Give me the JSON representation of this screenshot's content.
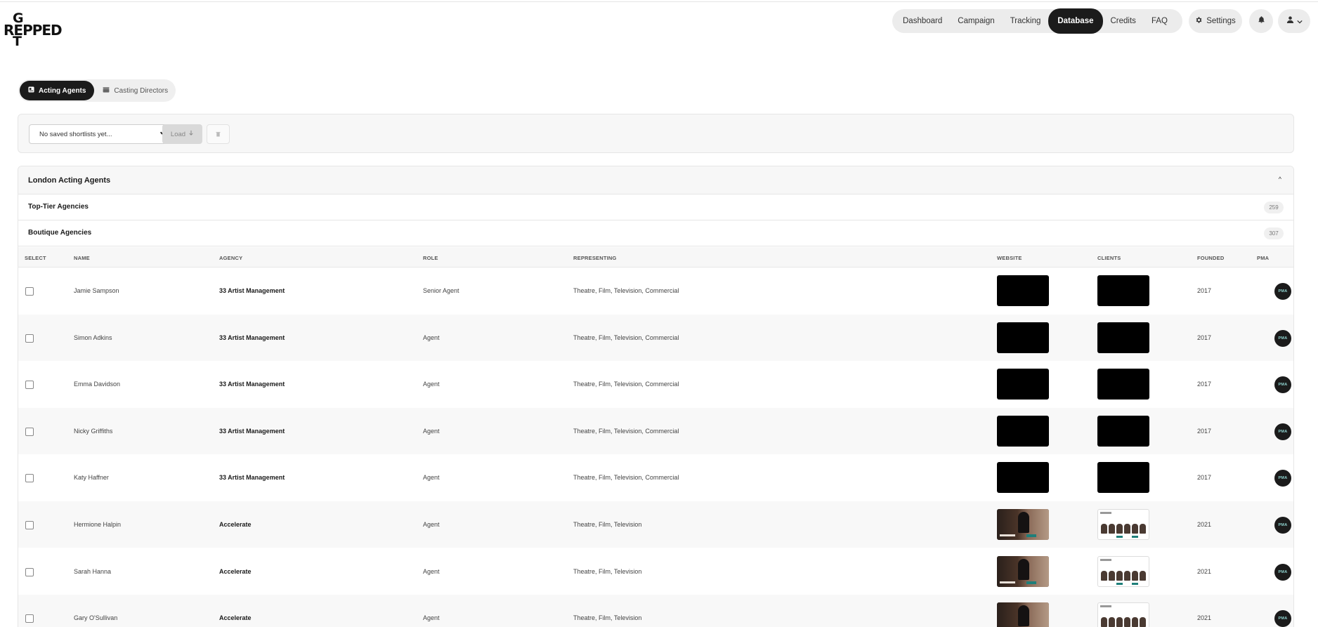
{
  "logo": {
    "line1": "G",
    "line2": "REPPED",
    "line3": "T"
  },
  "nav": {
    "items": [
      {
        "label": "Dashboard",
        "active": false
      },
      {
        "label": "Campaign",
        "active": false
      },
      {
        "label": "Tracking",
        "active": false
      },
      {
        "label": "Database",
        "active": true
      },
      {
        "label": "Credits",
        "active": false
      },
      {
        "label": "FAQ",
        "active": false
      }
    ],
    "settings_label": "Settings",
    "icons": {
      "settings": "gear-icon",
      "notifications": "bell-icon",
      "user": "user-icon",
      "user_menu": "chevron-down-icon"
    }
  },
  "tabs": [
    {
      "label": "Acting Agents",
      "icon": "id-card-icon",
      "active": true
    },
    {
      "label": "Casting Directors",
      "icon": "clapperboard-icon",
      "active": false
    }
  ],
  "shortlist": {
    "select_value": "No saved shortlists yet...",
    "load_label": "Load",
    "delete_icon": "trash-icon"
  },
  "database": {
    "section_title": "London Acting Agents",
    "collapse_icon": "^",
    "categories": [
      {
        "label": "Top-Tier Agencies",
        "count": "259"
      },
      {
        "label": "Boutique Agencies",
        "count": "307"
      }
    ],
    "columns": [
      "SELECT",
      "NAME",
      "AGENCY",
      "ROLE",
      "REPRESENTING",
      "WEBSITE",
      "CLIENTS",
      "FOUNDED",
      "PMA"
    ],
    "rows": [
      {
        "name": "Jamie Sampson",
        "agency": "33 Artist Management",
        "role": "Senior Agent",
        "representing": "Theatre, Film, Television, Commercial",
        "founded": "2017",
        "pma": "PMA",
        "thumb": "black"
      },
      {
        "name": "Simon Adkins",
        "agency": "33 Artist Management",
        "role": "Agent",
        "representing": "Theatre, Film, Television, Commercial",
        "founded": "2017",
        "pma": "PMA",
        "thumb": "black"
      },
      {
        "name": "Emma Davidson",
        "agency": "33 Artist Management",
        "role": "Agent",
        "representing": "Theatre, Film, Television, Commercial",
        "founded": "2017",
        "pma": "PMA",
        "thumb": "black"
      },
      {
        "name": "Nicky Griffiths",
        "agency": "33 Artist Management",
        "role": "Agent",
        "representing": "Theatre, Film, Television, Commercial",
        "founded": "2017",
        "pma": "PMA",
        "thumb": "black"
      },
      {
        "name": "Katy Haffner",
        "agency": "33 Artist Management",
        "role": "Agent",
        "representing": "Theatre, Film, Television, Commercial",
        "founded": "2017",
        "pma": "PMA",
        "thumb": "black"
      },
      {
        "name": "Hermione Halpin",
        "agency": "Accelerate",
        "role": "Agent",
        "representing": "Theatre, Film, Television",
        "founded": "2021",
        "pma": "PMA",
        "thumb": "image"
      },
      {
        "name": "Sarah Hanna",
        "agency": "Accelerate",
        "role": "Agent",
        "representing": "Theatre, Film, Television",
        "founded": "2021",
        "pma": "PMA",
        "thumb": "image"
      },
      {
        "name": "Gary O'Sullivan",
        "agency": "Accelerate",
        "role": "Agent",
        "representing": "Theatre, Film, Television",
        "founded": "2021",
        "pma": "PMA",
        "thumb": "image"
      }
    ]
  },
  "colors": {
    "accent_dark": "#1b1b1b",
    "pill_bg": "#ececec",
    "pma_text": "#8fd3cf"
  }
}
